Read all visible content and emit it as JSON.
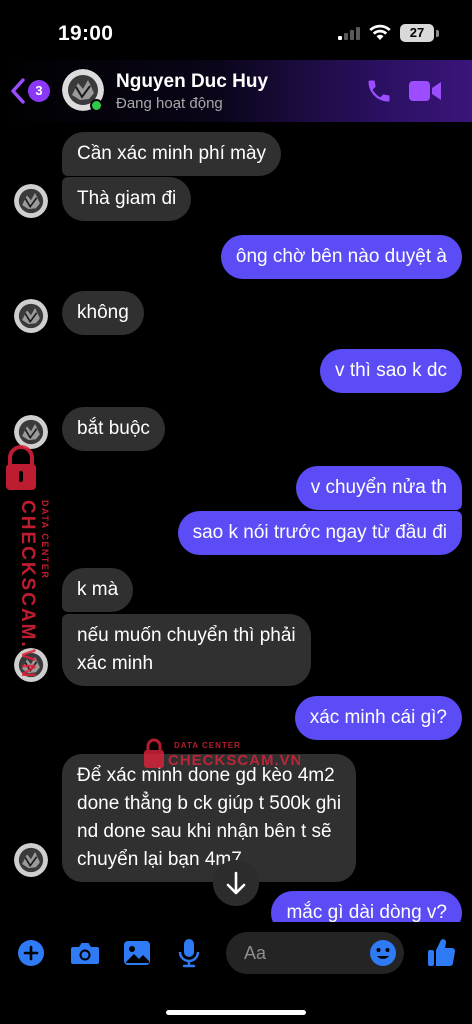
{
  "status_bar": {
    "time": "19:00",
    "battery": "27"
  },
  "header": {
    "back_badge": "3",
    "contact_name": "Nguyen Duc Huy",
    "contact_status": "Đang hoạt động"
  },
  "messages": [
    {
      "dir": "in",
      "text": "Cần xác minh phí mày"
    },
    {
      "dir": "in",
      "text": "Thà giam đi"
    },
    {
      "dir": "out",
      "text": "ông chờ bên nào duyệt à"
    },
    {
      "dir": "in",
      "text": "không"
    },
    {
      "dir": "out",
      "text": "v thì sao k dc"
    },
    {
      "dir": "in",
      "text": "bắt buộc"
    },
    {
      "dir": "out",
      "text": "v chuyển nửa th"
    },
    {
      "dir": "out",
      "text": "sao k nói trước ngay từ đầu đi"
    },
    {
      "dir": "in",
      "text": "k mà"
    },
    {
      "dir": "in",
      "lines": [
        "nếu muốn chuyển thì phải",
        "xác minh"
      ]
    },
    {
      "dir": "out",
      "text": "xác minh cái gì?"
    },
    {
      "dir": "in",
      "lines": [
        "Để xác minh done gd kèo 4m2",
        "done thẳng b ck giúp t 500k ghi",
        "nd done sau khi nhận bên t sẽ",
        "chuyển lại bạn 4m7"
      ]
    },
    {
      "dir": "out",
      "text": "mắc gì dài dòng v?"
    }
  ],
  "watermark": {
    "brand": "CHECKSCAM.VN",
    "tagline": "DATA CENTER"
  },
  "composer": {
    "placeholder": "Aa"
  },
  "colors": {
    "accent": "#7b3cf2",
    "outgoing_bubble": "#5b4cf5",
    "incoming_bubble": "#303030",
    "icon_blue": "#2f7bf6",
    "online": "#31c94a",
    "watermark_red": "#e0233a"
  },
  "icons": {
    "header": [
      "back-chevron-icon",
      "phone-icon",
      "video-camera-icon"
    ],
    "composer": [
      "plus-icon",
      "camera-icon",
      "image-icon",
      "microphone-icon",
      "emoji-icon",
      "thumbs-up-icon"
    ],
    "misc": [
      "arrow-down-icon",
      "lock-icon"
    ]
  }
}
